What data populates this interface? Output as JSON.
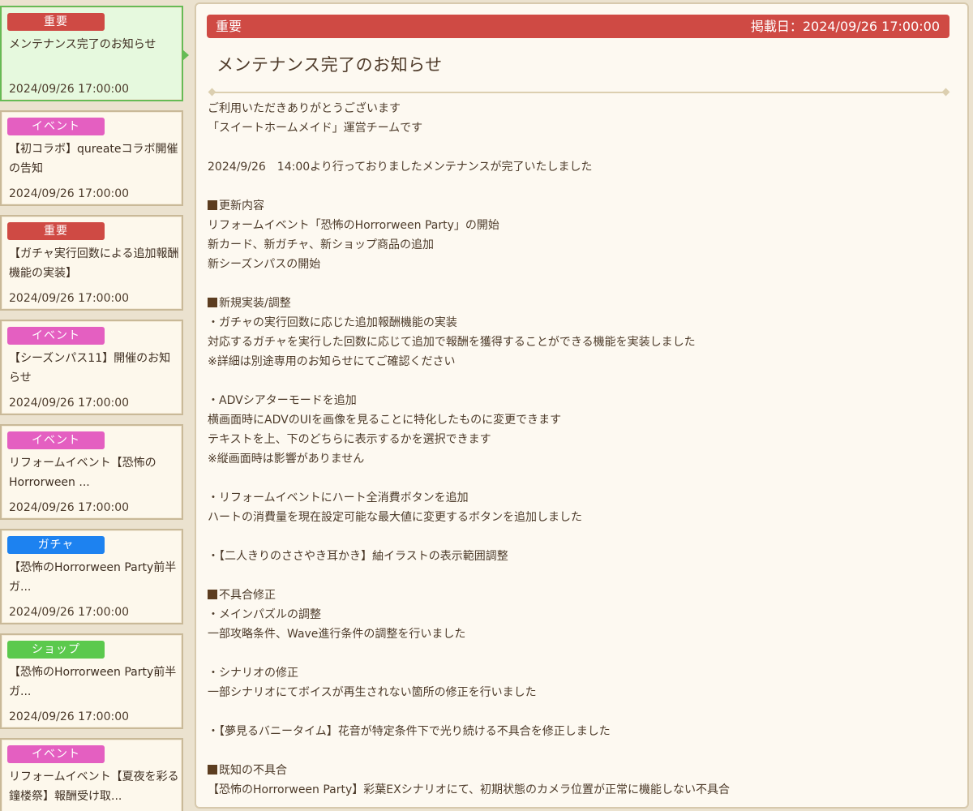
{
  "sidebar": {
    "items": [
      {
        "tag": "重要",
        "tag_color": "#cf4a44",
        "title": "メンテナンス完了のお知らせ",
        "date": "2024/09/26 17:00:00",
        "selected": true
      },
      {
        "tag": "イベント",
        "tag_color": "#e45fc1",
        "title": "【初コラボ】qureateコラボ開催の告知",
        "date": "2024/09/26 17:00:00",
        "selected": false
      },
      {
        "tag": "重要",
        "tag_color": "#cf4a44",
        "title": "【ガチャ実行回数による追加報酬機能の実装】",
        "date": "2024/09/26 17:00:00",
        "selected": false
      },
      {
        "tag": "イベント",
        "tag_color": "#e45fc1",
        "title": "【シーズンパス11】開催のお知らせ",
        "date": "2024/09/26 17:00:00",
        "selected": false
      },
      {
        "tag": "イベント",
        "tag_color": "#e45fc1",
        "title": "リフォームイベント【恐怖のHorrorween ...",
        "date": "2024/09/26 17:00:00",
        "selected": false
      },
      {
        "tag": "ガチャ",
        "tag_color": "#1d82f0",
        "title": "【恐怖のHorrorween Party前半ガ...",
        "date": "2024/09/26 17:00:00",
        "selected": false
      },
      {
        "tag": "ショップ",
        "tag_color": "#5bc94d",
        "title": "【恐怖のHorrorween Party前半ガ...",
        "date": "2024/09/26 17:00:00",
        "selected": false
      },
      {
        "tag": "イベント",
        "tag_color": "#e45fc1",
        "title": "リフォームイベント【夏夜を彩る鐘楼祭】報酬受け取...",
        "date": "",
        "selected": false
      }
    ]
  },
  "article": {
    "category": "重要",
    "category_color": "#cf4a44",
    "date_label": "掲載日：2024/09/26 17:00:00",
    "title": "メンテナンス完了のお知らせ",
    "lines": [
      {
        "text": "ご利用いただきありがとうございます"
      },
      {
        "text": "「スイートホームメイド」運営チームです"
      },
      {
        "text": ""
      },
      {
        "text": "2024/9/26　14:00より行っておりましたメンテナンスが完了いたしました"
      },
      {
        "text": ""
      },
      {
        "text": "更新内容",
        "heading": true
      },
      {
        "text": "リフォームイベント「恐怖のHorrorween Party」の開始"
      },
      {
        "text": "新カード、新ガチャ、新ショップ商品の追加"
      },
      {
        "text": "新シーズンパスの開始"
      },
      {
        "text": ""
      },
      {
        "text": "新規実装/調整",
        "heading": true
      },
      {
        "text": "・ガチャの実行回数に応じた追加報酬機能の実装"
      },
      {
        "text": "対応するガチャを実行した回数に応じて追加で報酬を獲得することができる機能を実装しました"
      },
      {
        "text": "※詳細は別途専用のお知らせにてご確認ください"
      },
      {
        "text": ""
      },
      {
        "text": "・ADVシアターモードを追加"
      },
      {
        "text": "横画面時にADVのUIを画像を見ることに特化したものに変更できます"
      },
      {
        "text": "テキストを上、下のどちらに表示するかを選択できます"
      },
      {
        "text": "※縦画面時は影響がありません"
      },
      {
        "text": ""
      },
      {
        "text": "・リフォームイベントにハート全消費ボタンを追加"
      },
      {
        "text": "ハートの消費量を現在設定可能な最大値に変更するボタンを追加しました"
      },
      {
        "text": ""
      },
      {
        "text": "・【二人きりのささやき耳かき】紬イラストの表示範囲調整"
      },
      {
        "text": ""
      },
      {
        "text": "不具合修正",
        "heading": true
      },
      {
        "text": "・メインパズルの調整"
      },
      {
        "text": "一部攻略条件、Wave進行条件の調整を行いました"
      },
      {
        "text": ""
      },
      {
        "text": "・シナリオの修正"
      },
      {
        "text": "一部シナリオにてボイスが再生されない箇所の修正を行いました"
      },
      {
        "text": ""
      },
      {
        "text": "・【夢見るバニータイム】花音が特定条件下で光り続ける不具合を修正しました"
      },
      {
        "text": ""
      },
      {
        "text": "既知の不具合",
        "heading": true
      },
      {
        "text": "【恐怖のHorrorween Party】彩葉EXシナリオにて、初期状態のカメラ位置が正常に機能しない不具合"
      }
    ]
  }
}
